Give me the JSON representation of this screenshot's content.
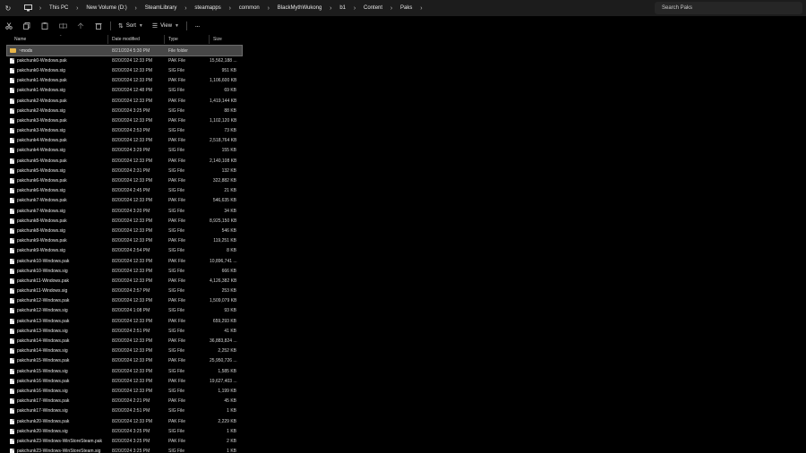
{
  "breadcrumbs": [
    "This PC",
    "New Volume (D:)",
    "SteamLibrary",
    "steamapps",
    "common",
    "BlackMythWukong",
    "b1",
    "Content",
    "Paks"
  ],
  "search": {
    "placeholder": "Search Paks"
  },
  "toolbar": {
    "sort_label": "Sort",
    "view_label": "View",
    "more_label": "···"
  },
  "columns": {
    "name": "Name",
    "date": "Date modified",
    "type": "Type",
    "size": "Size"
  },
  "colors": {
    "selected_row": "#474747",
    "folder": "#e8b64a",
    "background": "#000000"
  },
  "files": [
    {
      "name": "~mods",
      "date": "8/21/2024 5:30 PM",
      "type": "File folder",
      "size": "",
      "icon": "folder-icon",
      "selected": true
    },
    {
      "name": "pakchunk0-Windows.pak",
      "date": "8/20/2024 12:33 PM",
      "type": "PAK File",
      "size": "15,562,188 ...",
      "icon": "file-icon"
    },
    {
      "name": "pakchunk0-Windows.sig",
      "date": "8/20/2024 12:33 PM",
      "type": "SIG File",
      "size": "951 KB",
      "icon": "file-icon"
    },
    {
      "name": "pakchunk1-Windows.pak",
      "date": "8/20/2024 12:33 PM",
      "type": "PAK File",
      "size": "1,106,600 KB",
      "icon": "file-icon"
    },
    {
      "name": "pakchunk1-Windows.sig",
      "date": "8/20/2024 12:48 PM",
      "type": "SIG File",
      "size": "69 KB",
      "icon": "file-icon"
    },
    {
      "name": "pakchunk2-Windows.pak",
      "date": "8/20/2024 12:33 PM",
      "type": "PAK File",
      "size": "1,419,144 KB",
      "icon": "file-icon"
    },
    {
      "name": "pakchunk2-Windows.sig",
      "date": "8/20/2024 3:25 PM",
      "type": "SIG File",
      "size": "88 KB",
      "icon": "file-icon"
    },
    {
      "name": "pakchunk3-Windows.pak",
      "date": "8/20/2024 12:33 PM",
      "type": "PAK File",
      "size": "1,102,120 KB",
      "icon": "file-icon"
    },
    {
      "name": "pakchunk3-Windows.sig",
      "date": "8/20/2024 2:53 PM",
      "type": "SIG File",
      "size": "73 KB",
      "icon": "file-icon"
    },
    {
      "name": "pakchunk4-Windows.pak",
      "date": "8/20/2024 12:33 PM",
      "type": "PAK File",
      "size": "2,518,764 KB",
      "icon": "file-icon"
    },
    {
      "name": "pakchunk4-Windows.sig",
      "date": "8/20/2024 3:29 PM",
      "type": "SIG File",
      "size": "155 KB",
      "icon": "file-icon"
    },
    {
      "name": "pakchunk5-Windows.pak",
      "date": "8/20/2024 12:33 PM",
      "type": "PAK File",
      "size": "2,140,108 KB",
      "icon": "file-icon"
    },
    {
      "name": "pakchunk5-Windows.sig",
      "date": "8/20/2024 2:31 PM",
      "type": "SIG File",
      "size": "132 KB",
      "icon": "file-icon"
    },
    {
      "name": "pakchunk6-Windows.pak",
      "date": "8/20/2024 12:33 PM",
      "type": "PAK File",
      "size": "322,882 KB",
      "icon": "file-icon"
    },
    {
      "name": "pakchunk6-Windows.sig",
      "date": "8/20/2024 2:45 PM",
      "type": "SIG File",
      "size": "21 KB",
      "icon": "file-icon"
    },
    {
      "name": "pakchunk7-Windows.pak",
      "date": "8/20/2024 12:33 PM",
      "type": "PAK File",
      "size": "546,635 KB",
      "icon": "file-icon"
    },
    {
      "name": "pakchunk7-Windows.sig",
      "date": "8/20/2024 3:20 PM",
      "type": "SIG File",
      "size": "34 KB",
      "icon": "file-icon"
    },
    {
      "name": "pakchunk8-Windows.pak",
      "date": "8/20/2024 12:33 PM",
      "type": "PAK File",
      "size": "8,925,150 KB",
      "icon": "file-icon"
    },
    {
      "name": "pakchunk8-Windows.sig",
      "date": "8/20/2024 12:33 PM",
      "type": "SIG File",
      "size": "546 KB",
      "icon": "file-icon"
    },
    {
      "name": "pakchunk9-Windows.pak",
      "date": "8/20/2024 12:33 PM",
      "type": "PAK File",
      "size": "119,251 KB",
      "icon": "file-icon"
    },
    {
      "name": "pakchunk9-Windows.sig",
      "date": "8/20/2024 2:54 PM",
      "type": "SIG File",
      "size": "8 KB",
      "icon": "file-icon"
    },
    {
      "name": "pakchunk10-Windows.pak",
      "date": "8/20/2024 12:33 PM",
      "type": "PAK File",
      "size": "10,896,741 ...",
      "icon": "file-icon"
    },
    {
      "name": "pakchunk10-Windows.sig",
      "date": "8/20/2024 12:33 PM",
      "type": "SIG File",
      "size": "666 KB",
      "icon": "file-icon"
    },
    {
      "name": "pakchunk11-Windows.pak",
      "date": "8/20/2024 12:33 PM",
      "type": "PAK File",
      "size": "4,126,382 KB",
      "icon": "file-icon"
    },
    {
      "name": "pakchunk11-Windows.sig",
      "date": "8/20/2024 2:57 PM",
      "type": "SIG File",
      "size": "253 KB",
      "icon": "file-icon"
    },
    {
      "name": "pakchunk12-Windows.pak",
      "date": "8/20/2024 12:33 PM",
      "type": "PAK File",
      "size": "1,509,079 KB",
      "icon": "file-icon"
    },
    {
      "name": "pakchunk12-Windows.sig",
      "date": "8/20/2024 1:08 PM",
      "type": "SIG File",
      "size": "93 KB",
      "icon": "file-icon"
    },
    {
      "name": "pakchunk13-Windows.pak",
      "date": "8/20/2024 12:33 PM",
      "type": "PAK File",
      "size": "659,293 KB",
      "icon": "file-icon"
    },
    {
      "name": "pakchunk13-Windows.sig",
      "date": "8/20/2024 2:51 PM",
      "type": "SIG File",
      "size": "41 KB",
      "icon": "file-icon"
    },
    {
      "name": "pakchunk14-Windows.pak",
      "date": "8/20/2024 12:33 PM",
      "type": "PAK File",
      "size": "36,883,824 ...",
      "icon": "file-icon"
    },
    {
      "name": "pakchunk14-Windows.sig",
      "date": "8/20/2024 12:33 PM",
      "type": "SIG File",
      "size": "2,252 KB",
      "icon": "file-icon"
    },
    {
      "name": "pakchunk15-Windows.pak",
      "date": "8/20/2024 12:33 PM",
      "type": "PAK File",
      "size": "25,950,726 ...",
      "icon": "file-icon"
    },
    {
      "name": "pakchunk15-Windows.sig",
      "date": "8/20/2024 12:33 PM",
      "type": "SIG File",
      "size": "1,585 KB",
      "icon": "file-icon"
    },
    {
      "name": "pakchunk16-Windows.pak",
      "date": "8/20/2024 12:33 PM",
      "type": "PAK File",
      "size": "19,627,403 ...",
      "icon": "file-icon"
    },
    {
      "name": "pakchunk16-Windows.sig",
      "date": "8/20/2024 12:33 PM",
      "type": "SIG File",
      "size": "1,199 KB",
      "icon": "file-icon"
    },
    {
      "name": "pakchunk17-Windows.pak",
      "date": "8/20/2024 2:21 PM",
      "type": "PAK File",
      "size": "45 KB",
      "icon": "file-icon"
    },
    {
      "name": "pakchunk17-Windows.sig",
      "date": "8/20/2024 2:51 PM",
      "type": "SIG File",
      "size": "1 KB",
      "icon": "file-icon"
    },
    {
      "name": "pakchunk20-Windows.pak",
      "date": "8/20/2024 12:33 PM",
      "type": "PAK File",
      "size": "2,229 KB",
      "icon": "file-icon"
    },
    {
      "name": "pakchunk20-Windows.sig",
      "date": "8/20/2024 3:25 PM",
      "type": "SIG File",
      "size": "1 KB",
      "icon": "file-icon"
    },
    {
      "name": "pakchunk23-Windows-WinStoreSteam.pak",
      "date": "8/20/2024 3:25 PM",
      "type": "PAK File",
      "size": "2 KB",
      "icon": "file-icon"
    },
    {
      "name": "pakchunk23-Windows-WinStoreSteam.sig",
      "date": "8/20/2024 3:25 PM",
      "type": "SIG File",
      "size": "1 KB",
      "icon": "file-icon"
    }
  ]
}
